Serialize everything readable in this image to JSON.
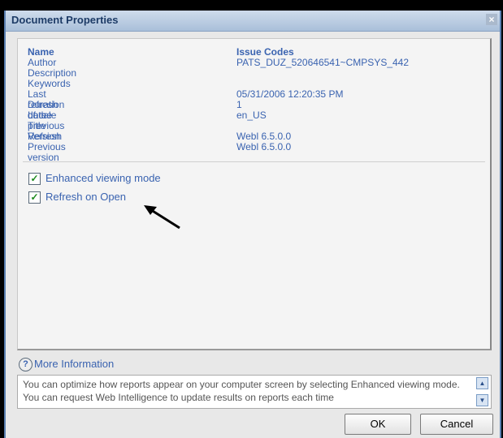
{
  "dialog": {
    "title": "Document Properties"
  },
  "properties": [
    {
      "label": "Name",
      "value": "Issue Codes"
    },
    {
      "label": "Author",
      "value": "PATS_DUZ_520646541~CMPSYS_442"
    },
    {
      "label": "Description",
      "value": ""
    },
    {
      "label": "Keywords",
      "value": ""
    },
    {
      "label": "Last refresh date",
      "value": "05/31/2006 12:20:35 PM"
    },
    {
      "label": "Duration of the previous Refresh",
      "value": "1"
    },
    {
      "label": "Locale",
      "value": "en_US"
    },
    {
      "label": "Title",
      "value": ""
    },
    {
      "label": "Version",
      "value": "Webl 6.5.0.0"
    },
    {
      "label": "Previous version",
      "value": "Webl 6.5.0.0"
    }
  ],
  "options": [
    {
      "label": "Enhanced viewing mode",
      "checked": true
    },
    {
      "label": "Refresh on Open",
      "checked": true
    }
  ],
  "info": {
    "heading": "More Information",
    "text": "You can optimize how reports appear on your computer screen by selecting Enhanced viewing mode. You can request Web Intelligence to update results on reports each time"
  },
  "buttons": {
    "ok": "OK",
    "cancel": "Cancel"
  },
  "colors": {
    "label": "#3a63b0",
    "titlebar": "#a9bfd9",
    "check": "#1d8a1d"
  },
  "icons": {
    "close": "close-icon",
    "help": "help-icon",
    "arrow": "arrow-annotation-icon"
  }
}
